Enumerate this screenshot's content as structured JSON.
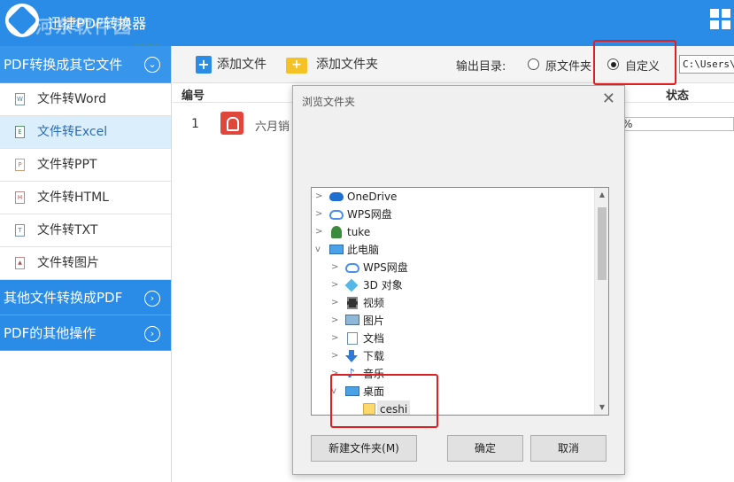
{
  "app": {
    "title": "迅捷PDF转换器",
    "watermark_name": "河东软件园",
    "watermark_url": "www.pc0359.cn",
    "brand_color": "#2b8ce8"
  },
  "sidebar": {
    "sections": [
      {
        "label": "PDF转换成其它文件",
        "icon": "chevron-down-icon",
        "expanded": true
      },
      {
        "label": "其他文件转换成PDF",
        "icon": "chevron-right-icon",
        "expanded": false
      },
      {
        "label": "PDF的其他操作",
        "icon": "chevron-right-icon",
        "expanded": false
      }
    ],
    "items": [
      {
        "label": "文件转Word",
        "icon": "word-file-icon",
        "glyph": "W"
      },
      {
        "label": "文件转Excel",
        "icon": "excel-file-icon",
        "glyph": "E",
        "active": true
      },
      {
        "label": "文件转PPT",
        "icon": "ppt-file-icon",
        "glyph": "P"
      },
      {
        "label": "文件转HTML",
        "icon": "html-file-icon",
        "glyph": "H"
      },
      {
        "label": "文件转TXT",
        "icon": "txt-file-icon",
        "glyph": "T"
      },
      {
        "label": "文件转图片",
        "icon": "image-file-icon",
        "glyph": "▲"
      }
    ]
  },
  "toolbar": {
    "add_file": "添加文件",
    "add_folder": "添加文件夹",
    "output_label": "输出目录:",
    "radio_original": "原文件夹",
    "radio_custom": "自定义",
    "selected_option": "自定义",
    "path_value": "C:\\Users\\t"
  },
  "table": {
    "headers": {
      "number": "编号",
      "status": "状态"
    },
    "rows": [
      {
        "number": "1",
        "name": "六月销",
        "progress_text": "%"
      }
    ]
  },
  "dialog": {
    "title": "浏览文件夹",
    "close_glyph": "✕",
    "tree": [
      {
        "label": "OneDrive",
        "level": 0,
        "arrow": ">",
        "icon": "onedrive-cloud-icon"
      },
      {
        "label": "WPS网盘",
        "level": 0,
        "arrow": ">",
        "icon": "wps-cloud-icon"
      },
      {
        "label": "tuke",
        "level": 0,
        "arrow": ">",
        "icon": "user-icon"
      },
      {
        "label": "此电脑",
        "level": 0,
        "arrow": "v",
        "icon": "computer-icon"
      },
      {
        "label": "WPS网盘",
        "level": 1,
        "arrow": ">",
        "icon": "wps-cloud-icon"
      },
      {
        "label": "3D 对象",
        "level": 1,
        "arrow": ">",
        "icon": "3d-objects-icon"
      },
      {
        "label": "视频",
        "level": 1,
        "arrow": ">",
        "icon": "video-icon"
      },
      {
        "label": "图片",
        "level": 1,
        "arrow": ">",
        "icon": "pictures-icon"
      },
      {
        "label": "文档",
        "level": 1,
        "arrow": ">",
        "icon": "documents-icon"
      },
      {
        "label": "下载",
        "level": 1,
        "arrow": ">",
        "icon": "download-icon"
      },
      {
        "label": "音乐",
        "level": 1,
        "arrow": ">",
        "icon": "music-icon"
      },
      {
        "label": "桌面",
        "level": 1,
        "arrow": "v",
        "icon": "desktop-icon"
      },
      {
        "label": "ceshi",
        "level": 2,
        "arrow": "",
        "icon": "folder-icon",
        "selected": true
      }
    ],
    "buttons": {
      "new_folder": "新建文件夹(M)",
      "ok": "确定",
      "cancel": "取消"
    }
  },
  "highlight_color": "#e02020"
}
